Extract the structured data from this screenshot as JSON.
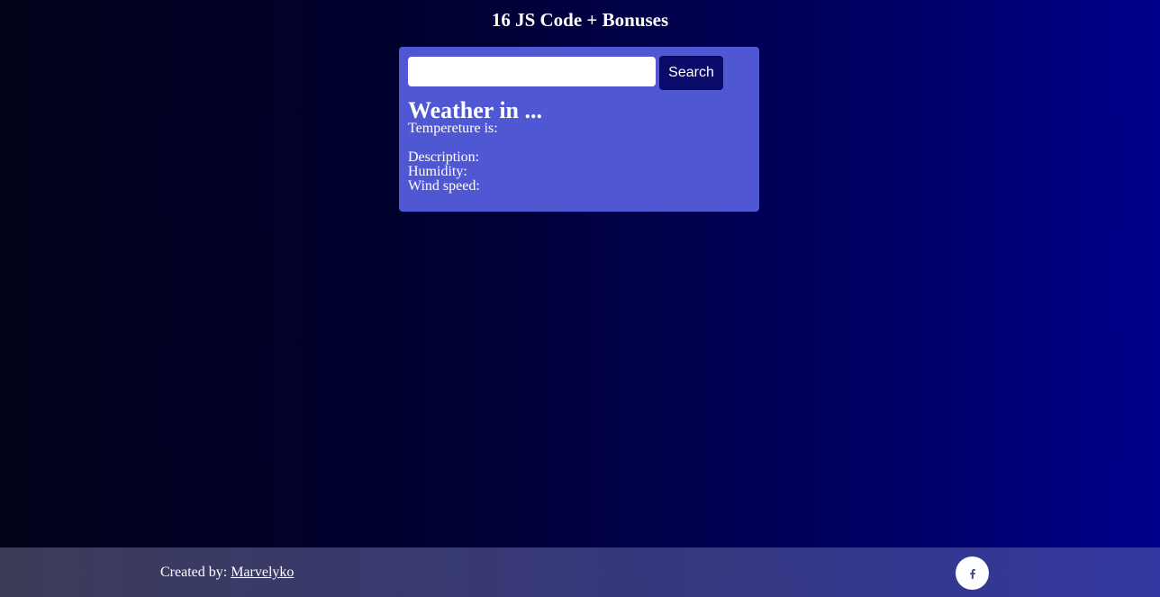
{
  "header": {
    "title": "16 JS Code + Bonuses"
  },
  "search": {
    "value": "",
    "button_label": "Search"
  },
  "weather": {
    "heading": "Weather in ...",
    "temperature_label": "Tempereture is:",
    "description_label": "Description:",
    "humidity_label": "Humidity:",
    "wind_label": "Wind speed:"
  },
  "footer": {
    "credit_prefix": "Created by: ",
    "author_link": "Marvelyko",
    "social_icon": "facebook-icon"
  },
  "colors": {
    "card_background": "#5057d3",
    "button_background": "#0a0a6a",
    "facebook_icon": "#3b4a8f"
  }
}
